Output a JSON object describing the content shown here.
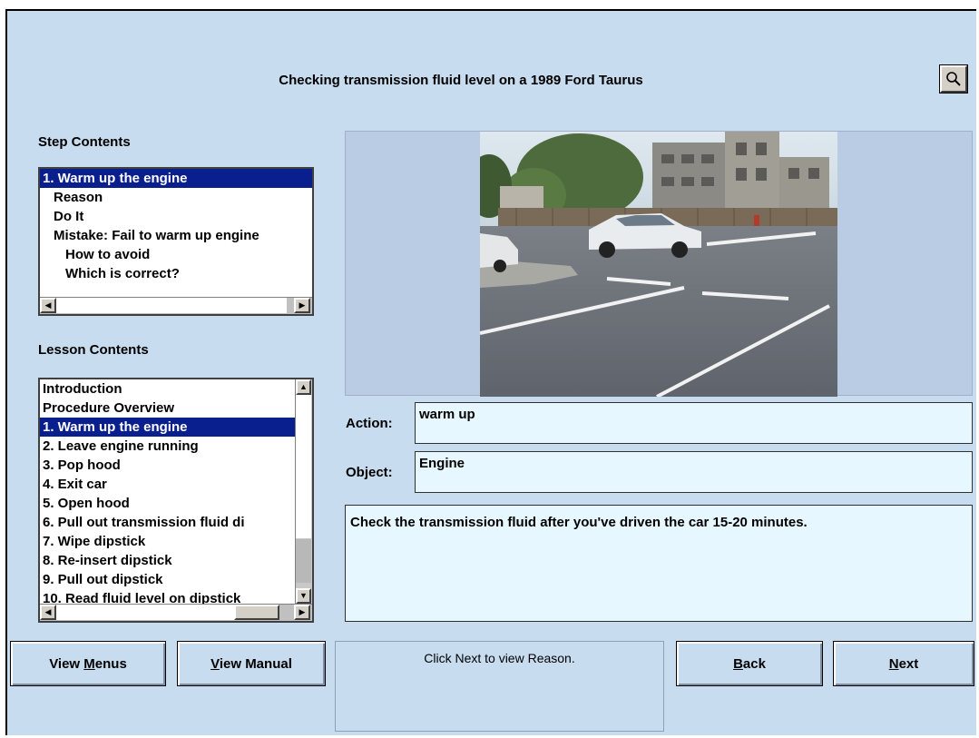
{
  "title": "Checking transmission fluid level on a 1989 Ford Taurus",
  "zoom_button": {
    "icon": "magnifier-icon"
  },
  "step_contents": {
    "label": "Step Contents",
    "items": [
      {
        "text": "1. Warm up the engine",
        "indent": 0,
        "selected": true
      },
      {
        "text": "Reason",
        "indent": 1,
        "selected": false
      },
      {
        "text": "Do It",
        "indent": 1,
        "selected": false
      },
      {
        "text": "Mistake: Fail to warm up engine",
        "indent": 1,
        "selected": false
      },
      {
        "text": "How to avoid",
        "indent": 2,
        "selected": false
      },
      {
        "text": "Which is correct?",
        "indent": 2,
        "selected": false
      }
    ]
  },
  "lesson_contents": {
    "label": "Lesson Contents",
    "items": [
      {
        "text": "Introduction",
        "selected": false
      },
      {
        "text": "Procedure Overview",
        "selected": false
      },
      {
        "text": "1. Warm up the engine",
        "selected": true
      },
      {
        "text": "2. Leave engine running",
        "selected": false
      },
      {
        "text": "3. Pop hood",
        "selected": false
      },
      {
        "text": "4. Exit car",
        "selected": false
      },
      {
        "text": "5. Open hood",
        "selected": false
      },
      {
        "text": "6. Pull out transmission fluid di",
        "selected": false
      },
      {
        "text": "7. Wipe dipstick",
        "selected": false
      },
      {
        "text": "8. Re-insert dipstick",
        "selected": false
      },
      {
        "text": "9. Pull out dipstick",
        "selected": false
      },
      {
        "text": "10. Read fluid level on dipstick",
        "selected": false
      }
    ]
  },
  "fields": {
    "action_label": "Action:",
    "action_value": "warm up",
    "object_label": "Object:",
    "object_value": "Engine",
    "description": "Check the transmission fluid after you've driven the car 15-20 minutes."
  },
  "buttons": {
    "view_menus_pre": "View ",
    "view_menus_key": "M",
    "view_menus_post": "enus",
    "view_manual_key": "V",
    "view_manual_post": "iew Manual",
    "back_key": "B",
    "back_post": "ack",
    "next_key": "N",
    "next_post": "ext"
  },
  "status_text": "Click Next to view Reason.",
  "colors": {
    "background": "#c8dcef",
    "selection": "#0a1f8e",
    "field_bg": "#e6f7ff"
  }
}
